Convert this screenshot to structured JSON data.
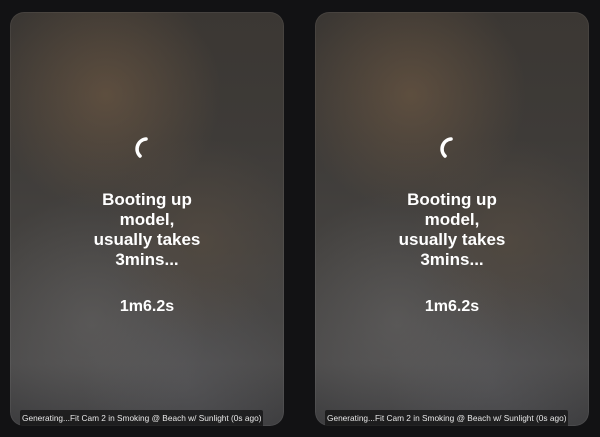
{
  "cards": [
    {
      "status_lines": [
        "Booting up",
        "model,",
        "usually takes",
        "3mins..."
      ],
      "elapsed": "1m6.2s",
      "caption": "Generating...Fit Cam 2 in Smoking @ Beach w/ Sunlight (0s ago)"
    },
    {
      "status_lines": [
        "Booting up",
        "model,",
        "usually takes",
        "3mins..."
      ],
      "elapsed": "1m6.2s",
      "caption": "Generating...Fit Cam 2 in Smoking @ Beach w/ Sunlight (0s ago)"
    }
  ],
  "colors": {
    "background": "#121214",
    "text": "#ffffff"
  },
  "icons": {
    "spinner": "loading-spinner-icon"
  }
}
